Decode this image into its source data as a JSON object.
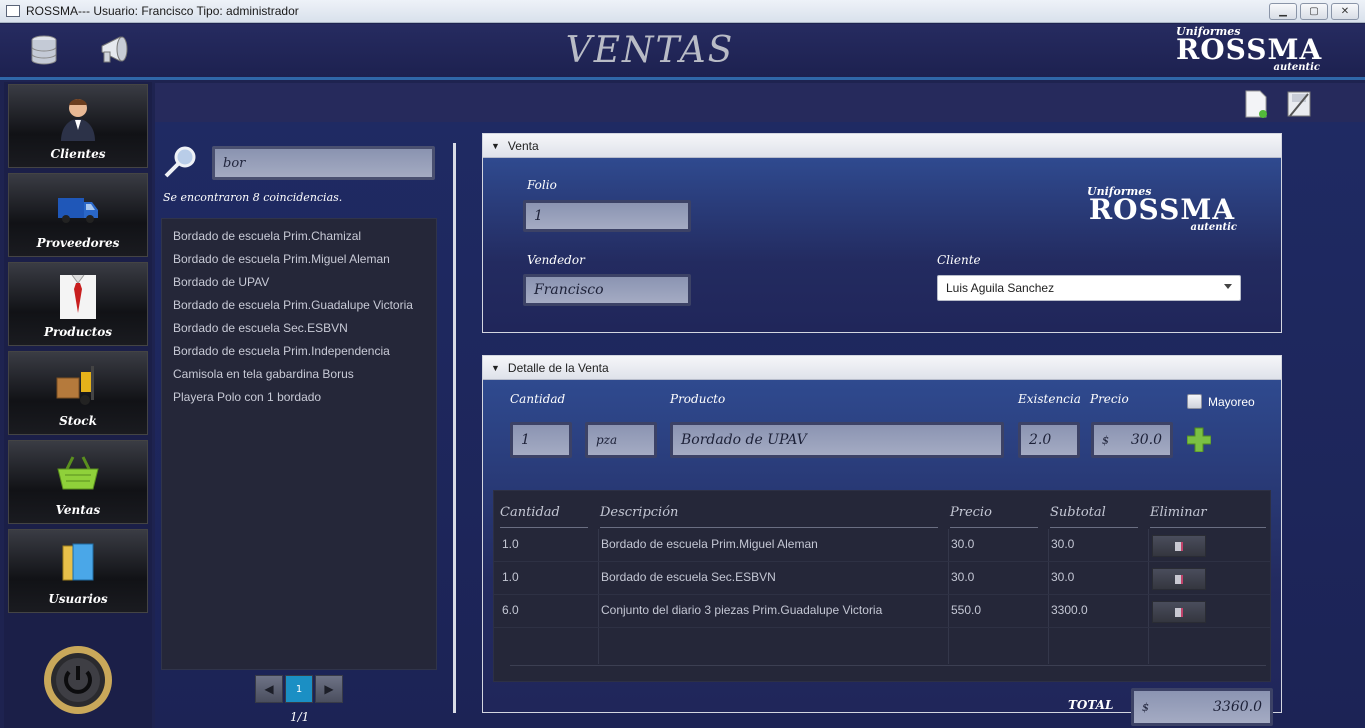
{
  "window": {
    "title": "ROSSMA--- Usuario: Francisco  Tipo: administrador",
    "controls": [
      "minimize-icon",
      "maximize-icon",
      "close-icon"
    ]
  },
  "header": {
    "title": "VENTAS",
    "icons": [
      "database-icon",
      "megaphone-icon"
    ],
    "logo": {
      "small": "Uniformes",
      "big": "ROSSMA",
      "tag": "autentic"
    }
  },
  "sidebar": {
    "items": [
      {
        "label": "Clientes",
        "icon": "user-icon"
      },
      {
        "label": "Proveedores",
        "icon": "van-icon"
      },
      {
        "label": "Productos",
        "icon": "shirt-icon"
      },
      {
        "label": "Stock",
        "icon": "forklift-icon"
      },
      {
        "label": "Ventas",
        "icon": "basket-icon"
      },
      {
        "label": "Usuarios",
        "icon": "folders-icon"
      }
    ],
    "power_icon": "power-icon"
  },
  "toolbar": {
    "icons": [
      "new-document-icon",
      "save-icon"
    ]
  },
  "search": {
    "value": "bor",
    "matches_text": "Se encontraron 8 coincidencias.",
    "results": [
      "Bordado de escuela Prim.Chamizal",
      "Bordado de escuela Prim.Miguel Aleman",
      "Bordado de UPAV",
      "Bordado de escuela Prim.Guadalupe Victoria",
      "Bordado de escuela Sec.ESBVN",
      "Bordado de escuela Prim.Independencia",
      "Camisola en tela gabardina Borus",
      "Playera Polo con 1 bordado"
    ],
    "pager": {
      "prev": "◀",
      "current": "1",
      "next": "▶",
      "info": "1/1"
    }
  },
  "venta": {
    "panel_title": "Venta",
    "folio_label": "Folio",
    "folio": "1",
    "vendedor_label": "Vendedor",
    "vendedor": "Francisco",
    "cliente_label": "Cliente",
    "cliente": "Luis Aguila Sanchez",
    "logo": {
      "small": "Uniformes",
      "big": "ROSSMA",
      "tag": "autentic"
    }
  },
  "detalle": {
    "panel_title": "Detalle de la Venta",
    "cantidad_label": "Cantidad",
    "cantidad": "1",
    "unidad": "pza",
    "producto_label": "Producto",
    "producto": "Bordado de UPAV",
    "existencia_label": "Existencia",
    "existencia": "2.0",
    "precio_label": "Precio",
    "precio_currency": "$",
    "precio": "30.0",
    "mayoreo_label": "Mayoreo",
    "mayoreo_checked": false,
    "add_icon": "plus-icon",
    "table": {
      "columns": [
        "Cantidad",
        "Descripción",
        "Precio",
        "Subtotal",
        "Eliminar"
      ],
      "rows": [
        {
          "cantidad": "1.0",
          "descripcion": "Bordado de escuela Prim.Miguel Aleman",
          "precio": "30.0",
          "subtotal": "30.0"
        },
        {
          "cantidad": "1.0",
          "descripcion": "Bordado de escuela Sec.ESBVN",
          "precio": "30.0",
          "subtotal": "30.0"
        },
        {
          "cantidad": "6.0",
          "descripcion": "Conjunto del diario 3 piezas Prim.Guadalupe Victoria",
          "precio": "550.0",
          "subtotal": "3300.0"
        }
      ],
      "delete_icon": "delete-icon"
    },
    "total_label": "TOTAL",
    "total_currency": "$",
    "total": "3360.0"
  },
  "colors": {
    "background": "#1e2350",
    "accent_blue": "#2f67a8",
    "pager_active": "#1b8fc4",
    "add_green": "#7bc043"
  }
}
